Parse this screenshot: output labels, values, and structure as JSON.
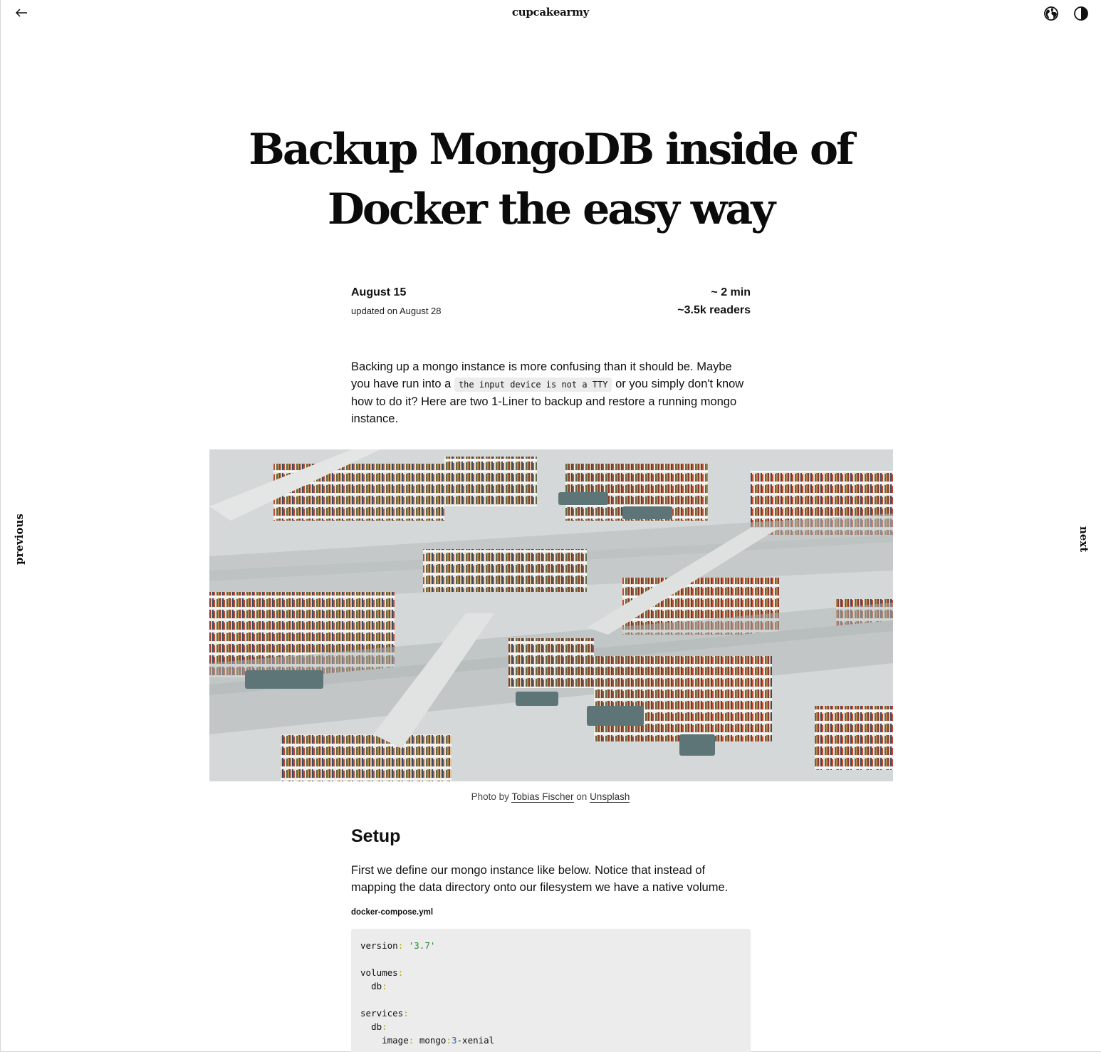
{
  "header": {
    "site_title": "cupcakearmy",
    "back_icon": "arrow-left-icon",
    "language_icon": "globe-icon",
    "theme_icon": "contrast-icon"
  },
  "nav": {
    "previous_label": "previous",
    "next_label": "next"
  },
  "post": {
    "title": "Backup MongoDB inside of Docker the easy way",
    "date": "August 15",
    "updated": "updated on August 28",
    "read_time": "~ 2 min",
    "readers": "~3.5k readers",
    "intro_before": "Backing up a mongo instance is more confusing than it should be. Maybe you have run into a",
    "intro_code": "the input device is not a TTY",
    "intro_after": "or you simply don't know how to do it? Here are two 1-Liner to backup and restore a running mongo instance.",
    "image_alt": "Photo of a multi-level white library with bookshelves and staircases",
    "caption": {
      "prefix": "Photo by",
      "author": "Tobias Fischer",
      "middle": "on",
      "source": "Unsplash"
    },
    "setup_heading": "Setup",
    "setup_text": "First we define our mongo instance like below. Notice that instead of mapping the data directory onto our filesystem we have a native volume.",
    "file_label": "docker-compose.yml",
    "code": {
      "version_key": "version",
      "version_val": "'3.7'",
      "volumes_key": "volumes",
      "db_key": "db",
      "services_key": "services",
      "image_key": "image",
      "image_name": "mongo",
      "image_tag_num": "3",
      "image_tag_rest": "-xenial"
    }
  },
  "colors": {
    "text": "#111111",
    "code_bg": "#ececec",
    "code_string": "#2c8a2c",
    "code_punct": "#b5a600"
  }
}
